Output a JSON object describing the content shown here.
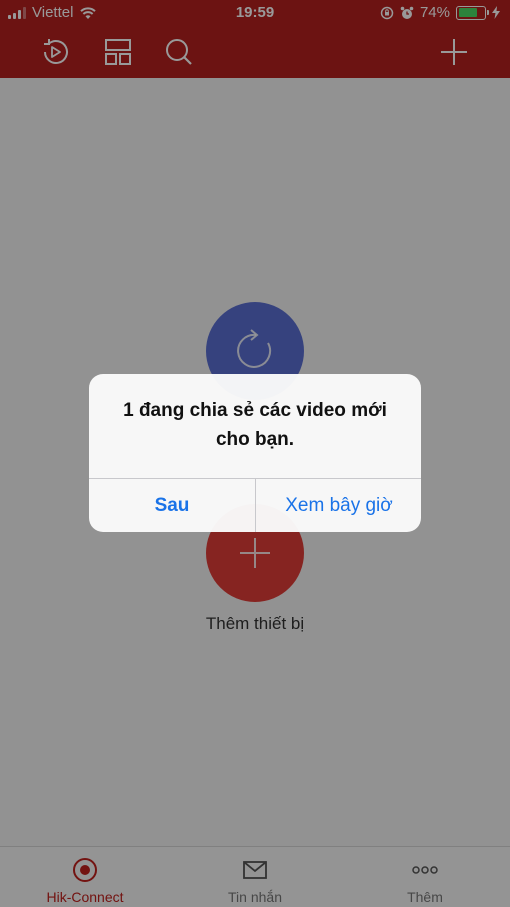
{
  "status_bar": {
    "carrier": "Viettel",
    "time": "19:59",
    "battery_percent": "74%",
    "battery_level": 0.74
  },
  "main": {
    "add_device_label": "Thêm thiết bị"
  },
  "tabbar": {
    "items": [
      {
        "label": "Hik-Connect",
        "icon": "record-icon",
        "active": true
      },
      {
        "label": "Tin nhắn",
        "icon": "envelope-icon",
        "active": false
      },
      {
        "label": "Thêm",
        "icon": "more-dots-icon",
        "active": false
      }
    ]
  },
  "alert": {
    "message": "1 đang chia sẻ các video mới cho bạn.",
    "later_label": "Sau",
    "view_now_label": "Xem bây giờ"
  },
  "colors": {
    "brand": "#b5211e",
    "alert_button": "#1a73e8",
    "active_tab": "#c0201d"
  }
}
